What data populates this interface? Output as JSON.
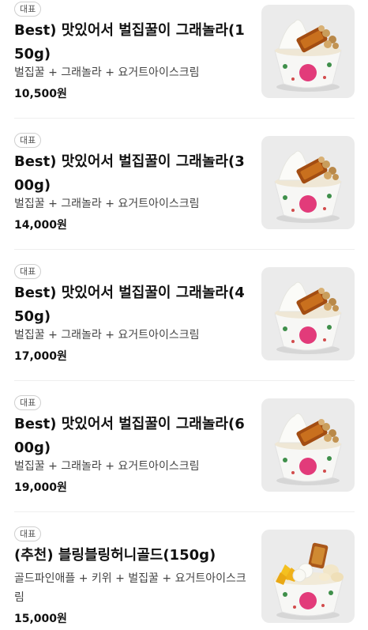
{
  "menu_items": [
    {
      "badge": "대표",
      "name": "Best) 맛있어서 벌집꿀이 그래놀라(150g)",
      "description": "벌집꿀 + 그래놀라 + 요거트아이스크림",
      "price": "10,500원",
      "image": "honeycomb-granola-yogurt-bowl"
    },
    {
      "badge": "대표",
      "name": "Best) 맛있어서 벌집꿀이 그래놀라(300g)",
      "description": "벌집꿀 + 그래놀라 + 요거트아이스크림",
      "price": "14,000원",
      "image": "honeycomb-granola-yogurt-bowl"
    },
    {
      "badge": "대표",
      "name": "Best) 맛있어서 벌집꿀이 그래놀라(450g)",
      "description": "벌집꿀 + 그래놀라 + 요거트아이스크림",
      "price": "17,000원",
      "image": "honeycomb-granola-yogurt-bowl"
    },
    {
      "badge": "대표",
      "name": "Best) 맛있어서 벌집꿀이 그래놀라(600g)",
      "description": "벌집꿀 + 그래놀라 + 요거트아이스크림",
      "price": "19,000원",
      "image": "honeycomb-granola-yogurt-bowl"
    },
    {
      "badge": "대표",
      "name": "(추천) 블링블링허니골드(150g)",
      "description": "골드파인애플 + 키위 + 벌집꿀 + 요거트아이스크림",
      "price": "15,000원",
      "image": "fruit-honeycomb-yogurt-bowl"
    }
  ]
}
